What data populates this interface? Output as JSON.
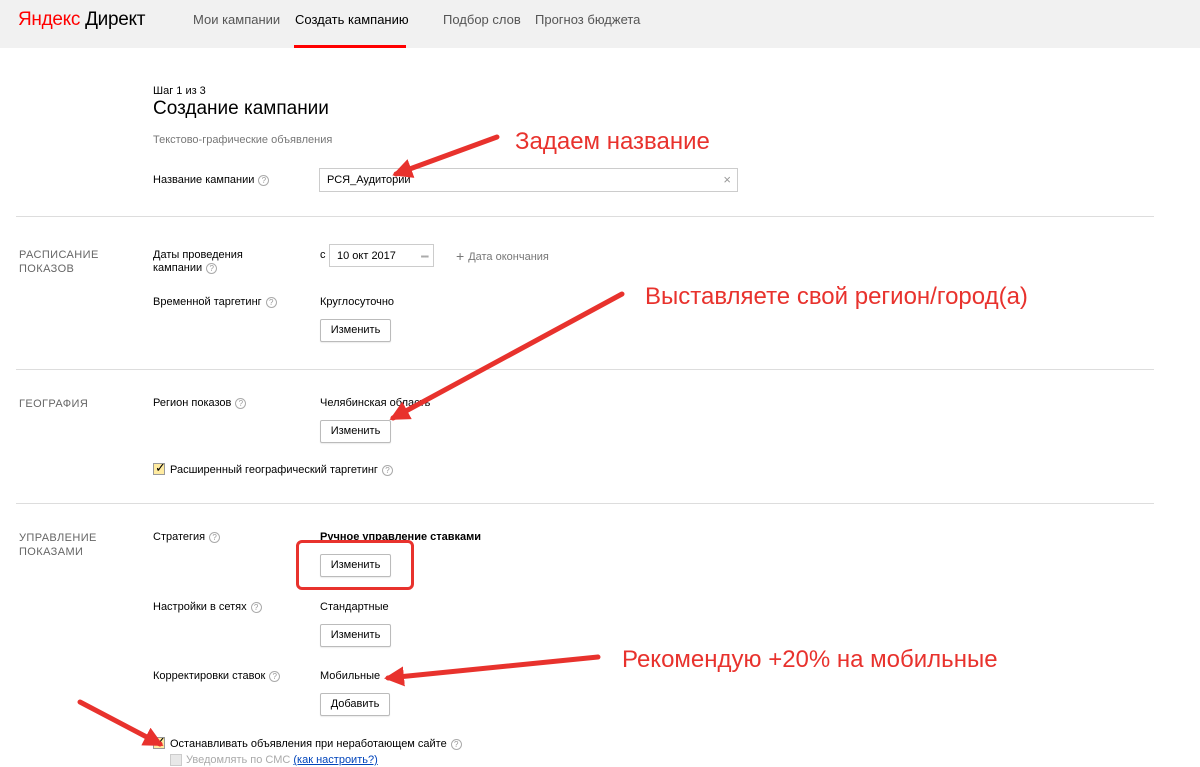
{
  "header": {
    "logo_ya": "Яндекс",
    "logo_rest": " Директ",
    "nav": [
      "Мои кампании",
      "Создать кампанию",
      "Подбор слов",
      "Прогноз бюджета"
    ]
  },
  "page": {
    "step": "Шаг 1 из 3",
    "title": "Создание кампании",
    "subtitle": "Текстово-графические объявления"
  },
  "campaign_name": {
    "label": "Название кампании",
    "value": "РСЯ_Аудитории",
    "clear_icon": "×"
  },
  "schedule": {
    "section": "РАСПИСАНИЕ ПОКАЗОВ",
    "dates_label": "Даты проведения кампании",
    "date_prefix": "с",
    "start_date": "10 окт 2017",
    "end_date_link": "Дата окончания",
    "time_label": "Временной таргетинг",
    "time_value": "Круглосуточно",
    "change": "Изменить"
  },
  "geo": {
    "section": "ГЕОГРАФИЯ",
    "region_label": "Регион показов",
    "region_value": "Челябинская область",
    "change": "Изменить",
    "extended_label": "Расширенный географический таргетинг"
  },
  "management": {
    "section": "УПРАВЛЕНИЕ ПОКАЗАМИ",
    "strategy_label": "Стратегия",
    "strategy_value": "Ручное управление ставками",
    "strategy_change": "Изменить",
    "networks_label": "Настройки в сетях",
    "networks_value": "Стандартные",
    "networks_change": "Изменить",
    "bids_label": "Корректировки ставок",
    "bids_value": "Мобильные",
    "bids_add": "Добавить",
    "stop_label": "Останавливать объявления при неработающем сайте",
    "sms_label": "Уведомлять по СМС",
    "sms_link": "(как настроить?)"
  },
  "annotations": {
    "name": "Задаем название",
    "region": "Выставляете свой регион/город(а)",
    "mobile": "Рекомендую +20% на мобильные"
  },
  "colors": {
    "brand_red": "#ff0000",
    "annotation_red": "#e8322d",
    "checkbox_fill": "#ffeba0"
  }
}
